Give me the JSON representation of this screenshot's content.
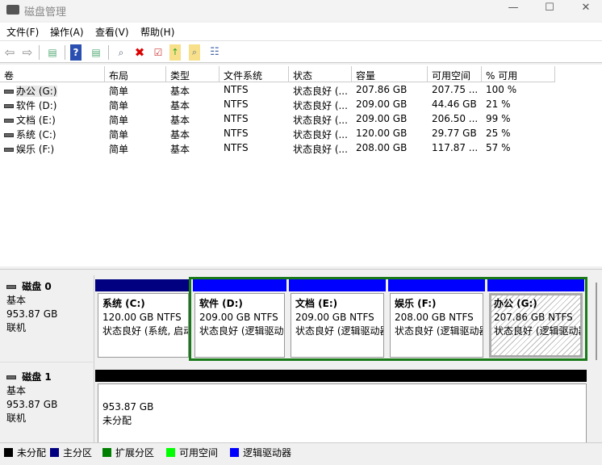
{
  "window": {
    "title": "磁盘管理",
    "controls": [
      "—",
      "☐",
      "✕"
    ]
  },
  "menu": [
    "文件(F)",
    "操作(A)",
    "查看(V)",
    "帮助(H)"
  ],
  "toolbar": [
    "back-icon",
    "forward-icon",
    "console-tree-icon",
    "help-icon",
    "action-pane-icon",
    "connect-disk-icon",
    "delete-icon",
    "properties-icon",
    "import-icon",
    "search-icon",
    "settings-list-icon"
  ],
  "volume_table": {
    "headers": [
      "卷",
      "布局",
      "类型",
      "文件系统",
      "状态",
      "容量",
      "可用空间",
      "% 可用"
    ],
    "rows": [
      [
        "办公 (G:)",
        "简单",
        "基本",
        "NTFS",
        "状态良好 (...",
        "207.86 GB",
        "207.75 ...",
        "100 %"
      ],
      [
        "软件 (D:)",
        "简单",
        "基本",
        "NTFS",
        "状态良好 (...",
        "209.00 GB",
        "44.46 GB",
        "21 %"
      ],
      [
        "文档 (E:)",
        "简单",
        "基本",
        "NTFS",
        "状态良好 (...",
        "209.00 GB",
        "206.50 ...",
        "99 %"
      ],
      [
        "系统 (C:)",
        "简单",
        "基本",
        "NTFS",
        "状态良好 (...",
        "120.00 GB",
        "29.77 GB",
        "25 %"
      ],
      [
        "娱乐 (F:)",
        "简单",
        "基本",
        "NTFS",
        "状态良好 (...",
        "208.00 GB",
        "117.87 ...",
        "57 %"
      ]
    ]
  },
  "disks": [
    {
      "name": "磁盘 0",
      "type": "基本",
      "size": "953.87 GB",
      "status": "联机",
      "partitions": [
        {
          "name": "系统  (C:)",
          "size": "120.00 GB NTFS",
          "status": "状态良好 (系统, 启动",
          "kind": "primary"
        },
        {
          "name": "软件  (D:)",
          "size": "209.00 GB NTFS",
          "status": "状态良好 (逻辑驱动器",
          "kind": "logical"
        },
        {
          "name": "文档  (E:)",
          "size": "209.00 GB NTFS",
          "status": "状态良好 (逻辑驱动器",
          "kind": "logical"
        },
        {
          "name": "娱乐  (F:)",
          "size": "208.00 GB NTFS",
          "status": "状态良好 (逻辑驱动器",
          "kind": "logical"
        },
        {
          "name": "办公  (G:)",
          "size": "207.86 GB NTFS",
          "status": "状态良好 (逻辑驱动器",
          "kind": "logical",
          "selected": true
        }
      ]
    },
    {
      "name": "磁盘 1",
      "type": "基本",
      "size": "953.87 GB",
      "status": "联机",
      "partitions": [
        {
          "size": "953.87 GB",
          "status": "未分配",
          "kind": "unallocated"
        }
      ]
    }
  ],
  "legend": [
    {
      "label": "未分配",
      "color": "#000000"
    },
    {
      "label": "主分区",
      "color": "#000080"
    },
    {
      "label": "扩展分区",
      "color": "#008000"
    },
    {
      "label": "可用空间",
      "color": "#00ff00"
    },
    {
      "label": "逻辑驱动器",
      "color": "#0000ff"
    }
  ]
}
